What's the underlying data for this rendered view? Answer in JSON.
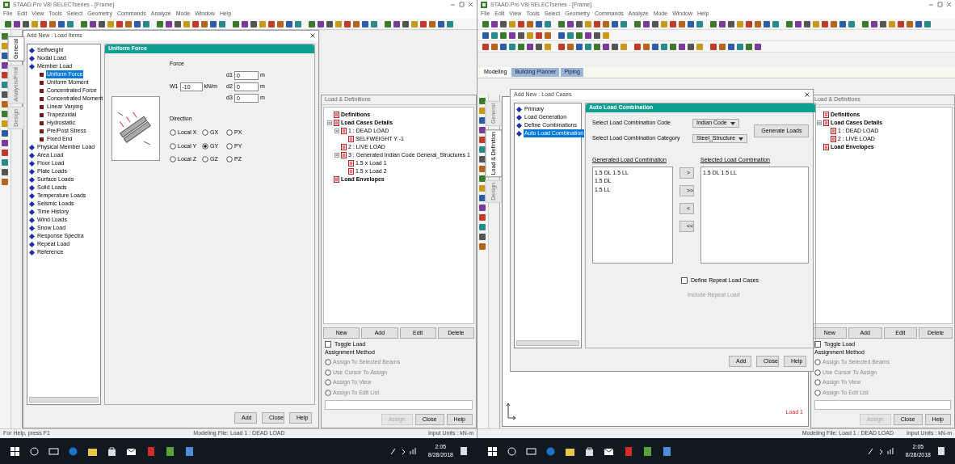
{
  "left_window": {
    "title": "STAAD.Pro V8i SELECTseries - [Frame]",
    "menu": [
      "File",
      "Edit",
      "View",
      "Tools",
      "Select",
      "Geometry",
      "Commands",
      "Analyze",
      "Mode",
      "Window",
      "Help"
    ],
    "side_tabs": [
      {
        "label": "General",
        "selected": true
      },
      {
        "label": "Analysis/Print",
        "selected": false
      },
      {
        "label": "Design",
        "selected": false
      }
    ],
    "dialog": {
      "title": "Add New : Load Items",
      "tree": [
        {
          "label": "Selfweight",
          "selected": false
        },
        {
          "label": "Nodal Load",
          "selected": false
        },
        {
          "label": "Member Load",
          "selected": false,
          "children": [
            {
              "label": "Uniform Force",
              "selected": true
            },
            {
              "label": "Uniform Moment",
              "selected": false
            },
            {
              "label": "Concentrated Force",
              "selected": false
            },
            {
              "label": "Concentrated Moment",
              "selected": false
            },
            {
              "label": "Linear Varying",
              "selected": false
            },
            {
              "label": "Trapezoidal",
              "selected": false
            },
            {
              "label": "Hydrostatic",
              "selected": false
            },
            {
              "label": "Pre/Post Stress",
              "selected": false
            },
            {
              "label": "Fixed End",
              "selected": false
            }
          ]
        },
        {
          "label": "Physical Member Load",
          "selected": false
        },
        {
          "label": "Area Load",
          "selected": false
        },
        {
          "label": "Floor Load",
          "selected": false
        },
        {
          "label": "Plate Loads",
          "selected": false
        },
        {
          "label": "Surface Loads",
          "selected": false
        },
        {
          "label": "Solid Loads",
          "selected": false
        },
        {
          "label": "Temperature Loads",
          "selected": false
        },
        {
          "label": "Seismic Loads",
          "selected": false
        },
        {
          "label": "Time History",
          "selected": false
        },
        {
          "label": "Wind Loads",
          "selected": false
        },
        {
          "label": "Snow Load",
          "selected": false
        },
        {
          "label": "Response Spectra",
          "selected": false
        },
        {
          "label": "Repeat Load",
          "selected": false
        },
        {
          "label": "Reference",
          "selected": false
        }
      ],
      "panel": {
        "title": "Uniform Force",
        "group": "Force",
        "w1": {
          "label": "W1",
          "value": "-10",
          "unit": "kN/m"
        },
        "distances": [
          {
            "label": "d1",
            "value": "0",
            "unit": "m"
          },
          {
            "label": "d2",
            "value": "0",
            "unit": "m"
          },
          {
            "label": "d3",
            "value": "0",
            "unit": "m"
          }
        ],
        "direction_label": "Direction",
        "directions": [
          {
            "label": "Local X",
            "selected": false
          },
          {
            "label": "GX",
            "selected": false
          },
          {
            "label": "PX",
            "selected": false
          },
          {
            "label": "Local Y",
            "selected": false
          },
          {
            "label": "GY",
            "selected": true
          },
          {
            "label": "PY",
            "selected": false
          },
          {
            "label": "Local Z",
            "selected": false
          },
          {
            "label": "GZ",
            "selected": false
          },
          {
            "label": "PZ",
            "selected": false
          }
        ]
      },
      "buttons": [
        "Add",
        "Close",
        "Help"
      ]
    },
    "load_panel": {
      "title": "Load & Definitions",
      "tree": [
        {
          "label": "Definitions",
          "bold": true
        },
        {
          "label": "Load Cases Details",
          "bold": true,
          "children": [
            {
              "label": "1 : DEAD LOAD",
              "bold": false,
              "children": [
                {
                  "label": "SELFWEIGHT Y -1",
                  "bold": false
                }
              ]
            },
            {
              "label": "2 : LIVE LOAD",
              "bold": false
            },
            {
              "label": "3 : Generated Indian Code General_Structures 1",
              "bold": false,
              "children": [
                {
                  "label": "1.5 x Load 1",
                  "bold": false
                },
                {
                  "label": "1.5 x Load 2",
                  "bold": false
                }
              ]
            }
          ]
        },
        {
          "label": "Load Envelopes",
          "bold": true
        }
      ],
      "buttons": [
        "New",
        "Add",
        "Edit",
        "Delete"
      ],
      "toggle": {
        "label": "Toggle Load",
        "checked": false
      },
      "assign_label": "Assignment Method",
      "assign_options": [
        {
          "label": "Assign To Selected Beams",
          "selected": false
        },
        {
          "label": "Use Cursor To Assign",
          "selected": false
        },
        {
          "label": "Assign To View",
          "selected": false
        },
        {
          "label": "Assign To Edit List",
          "selected": false
        }
      ],
      "action_buttons": [
        {
          "label": "Assign",
          "disabled": true
        },
        {
          "label": "Close",
          "disabled": false
        },
        {
          "label": "Help",
          "disabled": false
        }
      ]
    },
    "status_bar": [
      "For Help, press F1",
      "Modeling File: Load 1 : DEAD LOAD",
      "Input Units : kN-m"
    ]
  },
  "right_window": {
    "title": "STAAD.Pro V8i SELECTseries - [Frame]",
    "menu": [
      "File",
      "Edit",
      "View",
      "Tools",
      "Select",
      "Geometry",
      "Commands",
      "Analyze",
      "Mode",
      "Window",
      "Help"
    ],
    "mode_tabs": [
      {
        "label": "Modeling",
        "selected": true
      },
      {
        "label": "Building Planner",
        "selected": false
      },
      {
        "label": "Piping",
        "selected": false
      }
    ],
    "side_tabs": [
      {
        "label": "General",
        "selected": false
      },
      {
        "label": "Load & Definition",
        "selected": true
      },
      {
        "label": "Design",
        "selected": false
      }
    ],
    "view_label": "Load 1",
    "dialog": {
      "title": "Add New : Load Cases",
      "tree": [
        {
          "label": "Primary",
          "selected": false
        },
        {
          "label": "Load Generation",
          "selected": false
        },
        {
          "label": "Define Combinations",
          "selected": false
        },
        {
          "label": "Auto Load Combination",
          "selected": true
        }
      ],
      "panel": {
        "title": "Auto Load Combination",
        "code_label": "Select Load Combination Code",
        "code_value": "Indian Code",
        "category_label": "Select Load Combination Category",
        "category_value": "Steel_Structure",
        "generate_button": "Generate Loads",
        "generated_label": "Generated Load Combination",
        "generated": [
          "1.5 DL 1.5 LL",
          "1.5 DL",
          "1.5 LL"
        ],
        "selected_label": "Selected Load Combination",
        "selected_items": [
          "1.5 DL 1.5 LL"
        ],
        "arrows": [
          ">",
          ">>",
          "<",
          "<<"
        ],
        "repeat": {
          "label": "Define Repeat Load Cases",
          "checked": false
        },
        "include_label": "Include Repeat Load"
      },
      "buttons": [
        "Add",
        "Close",
        "Help"
      ]
    },
    "load_panel": {
      "title": "Load & Definitions",
      "tree": [
        {
          "label": "Definitions",
          "bold": true
        },
        {
          "label": "Load Cases Details",
          "bold": true,
          "children": [
            {
              "label": "1 : DEAD LOAD",
              "bold": false
            },
            {
              "label": "2 : LIVE LOAD",
              "bold": false
            }
          ]
        },
        {
          "label": "Load Envelopes",
          "bold": true
        }
      ],
      "buttons": [
        "New",
        "Add",
        "Edit",
        "Delete"
      ],
      "toggle": {
        "label": "Toggle Load",
        "checked": false
      },
      "assign_label": "Assignment Method",
      "assign_options": [
        {
          "label": "Assign To Selected Beams",
          "selected": false
        },
        {
          "label": "Use Cursor To Assign",
          "selected": false
        },
        {
          "label": "Assign To View",
          "selected": false
        },
        {
          "label": "Assign To Edit List",
          "selected": false
        }
      ],
      "action_buttons": [
        {
          "label": "Assign",
          "disabled": true
        },
        {
          "label": "Close",
          "disabled": false
        },
        {
          "label": "Help",
          "disabled": false
        }
      ]
    },
    "status_bar": [
      "Modeling File: Load 1 : DEAD LOAD",
      "Input Units : kN-m"
    ]
  },
  "taskbars": [
    {
      "time": "2:05",
      "date": "8/28/2018"
    },
    {
      "time": "2:05",
      "date": "8/28/2018"
    }
  ]
}
